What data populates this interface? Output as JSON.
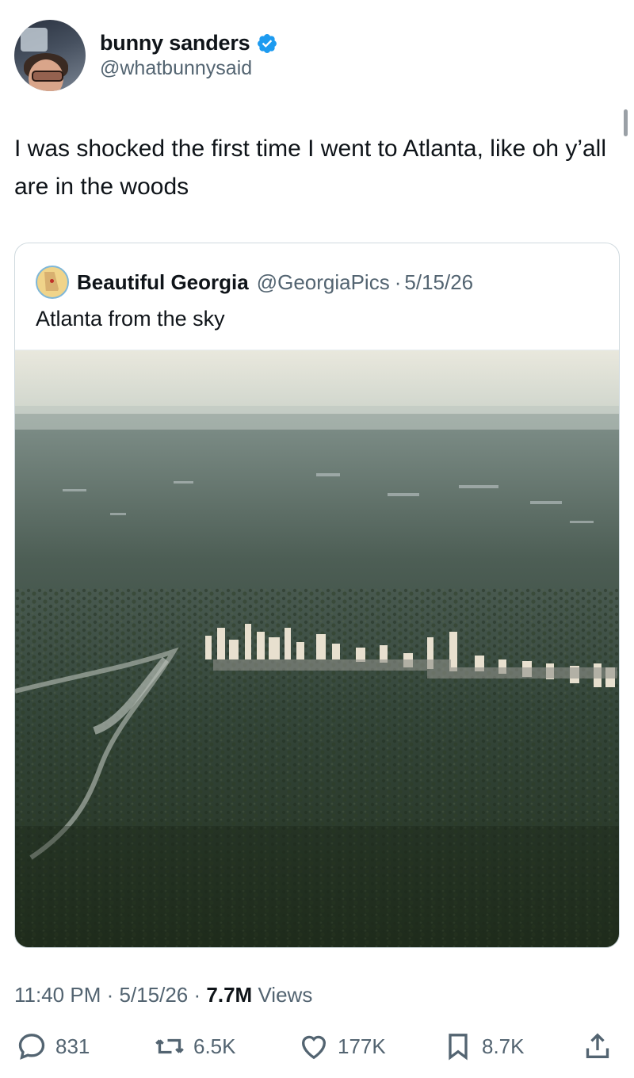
{
  "author": {
    "display_name": "bunny sanders",
    "handle": "@whatbunnysaid",
    "verified": true
  },
  "tweet": {
    "text": "I was shocked the first time I went to Atlanta, like oh y’all are in the woods"
  },
  "quoted": {
    "display_name": "Beautiful Georgia",
    "handle": "@GeorgiaPics",
    "separator": "·",
    "date": "5/15/26",
    "text": "Atlanta from the sky"
  },
  "meta": {
    "time": "11:40 PM",
    "sep1": "·",
    "date": "5/15/26",
    "sep2": "·",
    "views_count": "7.7M",
    "views_label": "Views"
  },
  "actions": {
    "replies": "831",
    "reposts": "6.5K",
    "likes": "177K",
    "bookmarks": "8.7K"
  },
  "icons": {
    "verified": "verified-badge-icon",
    "reply": "reply-icon",
    "repost": "repost-icon",
    "like": "heart-icon",
    "bookmark": "bookmark-icon",
    "share": "share-icon"
  },
  "colors": {
    "verified_blue": "#1d9bf0",
    "secondary_text": "#536471",
    "primary_text": "#0f1419"
  }
}
